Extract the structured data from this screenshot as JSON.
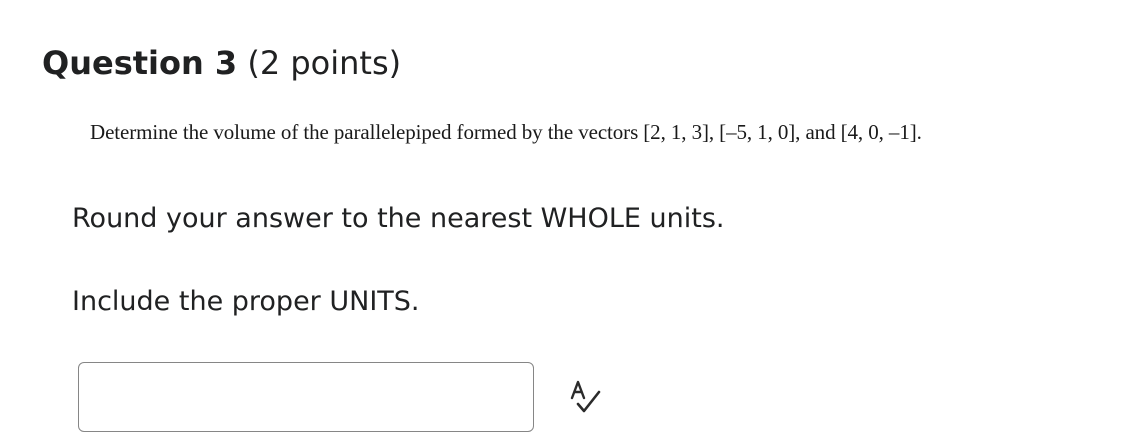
{
  "question": {
    "title": "Question 3",
    "points": "(2 points)",
    "prompt": "Determine the volume of the parallelepiped formed by the vectors [2, 1, 3], [–5, 1, 0], and [4, 0, –1].",
    "instructions": {
      "round": "Round your answer to the nearest WHOLE units.",
      "units": "Include the proper UNITS."
    }
  },
  "answer": {
    "value": "",
    "placeholder": ""
  },
  "icons": {
    "spellcheck": "spellcheck-icon"
  }
}
